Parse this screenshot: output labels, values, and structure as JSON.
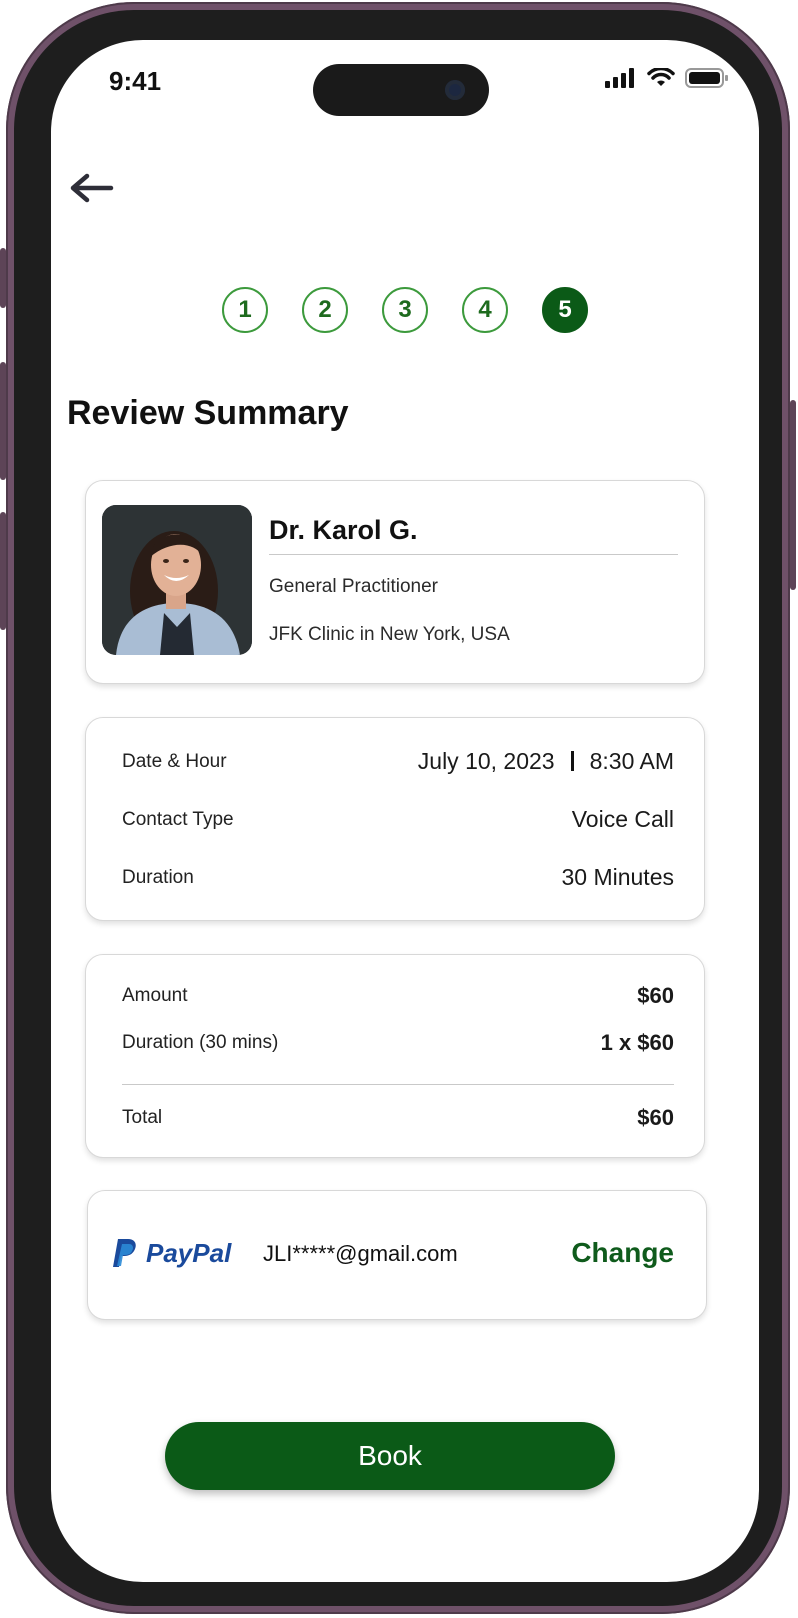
{
  "status_bar": {
    "time": "9:41"
  },
  "steps": [
    "1",
    "2",
    "3",
    "4",
    "5"
  ],
  "active_step": 5,
  "page_title": "Review Summary",
  "doctor": {
    "name": "Dr. Karol G.",
    "specialty": "General Practitioner",
    "clinic": "JFK Clinic in New York, USA"
  },
  "appointment": {
    "date_label": "Date & Hour",
    "date": "July 10, 2023",
    "hour": "8:30 AM",
    "contact_label": "Contact Type",
    "contact": "Voice Call",
    "duration_label": "Duration",
    "duration": "30 Minutes"
  },
  "payment": {
    "amount_label": "Amount",
    "amount": "$60",
    "duration_label": "Duration (30 mins)",
    "duration_value": "1 x $60",
    "total_label": "Total",
    "total": "$60"
  },
  "method": {
    "provider": "PayPal",
    "email": "JLI*****@gmail.com",
    "change_label": "Change"
  },
  "book_label": "Book",
  "colors": {
    "primary": "#0b5a17",
    "step_outline": "#3c9a3c",
    "frame": "#6f5169",
    "paypal_dark": "#1a4a9c",
    "paypal_light": "#2b8ad6"
  }
}
